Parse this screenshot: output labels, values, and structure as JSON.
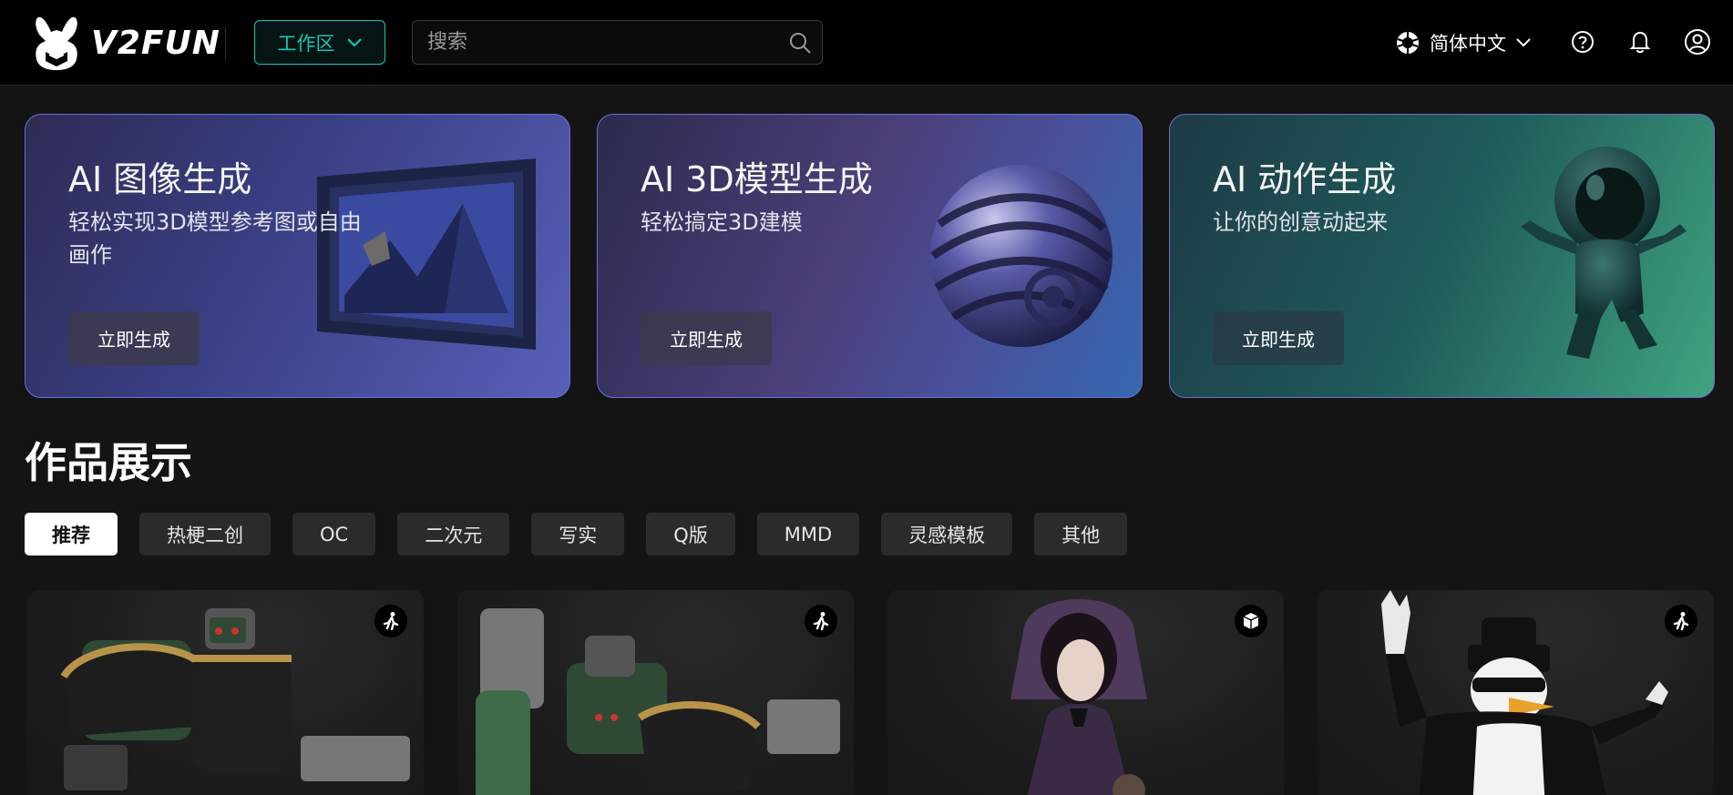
{
  "header": {
    "logo_text": "V2FUN",
    "workspace_label": "工作区",
    "search_placeholder": "搜索",
    "language_label": "简体中文"
  },
  "features": [
    {
      "title": "AI 图像生成",
      "subtitle": "轻松实现3D模型参考图或自由画作",
      "button": "立即生成"
    },
    {
      "title": "AI 3D模型生成",
      "subtitle": "轻松搞定3D建模",
      "button": "立即生成"
    },
    {
      "title": "AI 动作生成",
      "subtitle": "让你的创意动起来",
      "button": "立即生成"
    }
  ],
  "showcase": {
    "title": "作品展示",
    "filters": [
      "推荐",
      "热梗二创",
      "OC",
      "二次元",
      "写实",
      "Q版",
      "MMD",
      "灵感模板",
      "其他"
    ],
    "active_filter": "推荐"
  },
  "gallery": [
    {
      "type_icon": "running-figure-icon"
    },
    {
      "type_icon": "running-figure-icon"
    },
    {
      "type_icon": "3d-cube-icon"
    },
    {
      "type_icon": "running-figure-icon"
    }
  ],
  "colors": {
    "accent": "#19c4b4",
    "background": "#141414",
    "header": "#000000",
    "chip": "#2b2b2b"
  }
}
